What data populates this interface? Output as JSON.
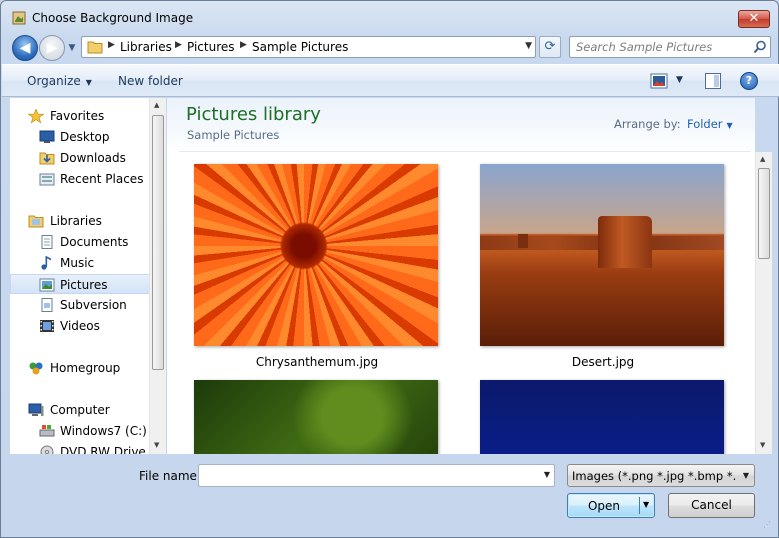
{
  "window": {
    "title": "Choose Background Image",
    "close_label": "✕"
  },
  "nav": {
    "back_glyph": "◀",
    "forward_glyph": "▶",
    "recent_glyph": "▼",
    "refresh_glyph": "⟳"
  },
  "address": {
    "crumbs": [
      "Libraries",
      "Pictures",
      "Sample Pictures"
    ],
    "separator": "▶",
    "dropdown_glyph": "▼"
  },
  "search": {
    "placeholder": "Search Sample Pictures"
  },
  "toolbar": {
    "organize_label": "Organize",
    "new_folder_label": "New folder",
    "caret": "▼",
    "help_label": "?"
  },
  "sidebar": {
    "items": [
      {
        "label": "Favorites",
        "icon": "star-icon"
      },
      {
        "label": "Desktop",
        "icon": "desktop-icon"
      },
      {
        "label": "Downloads",
        "icon": "downloads-folder-icon"
      },
      {
        "label": "Recent Places",
        "icon": "recent-places-icon"
      },
      {
        "label": "Libraries",
        "icon": "library-icon"
      },
      {
        "label": "Documents",
        "icon": "documents-icon"
      },
      {
        "label": "Music",
        "icon": "music-icon"
      },
      {
        "label": "Pictures",
        "icon": "pictures-icon",
        "selected": true
      },
      {
        "label": "Subversion",
        "icon": "subversion-icon"
      },
      {
        "label": "Videos",
        "icon": "videos-icon"
      },
      {
        "label": "Homegroup",
        "icon": "homegroup-icon"
      },
      {
        "label": "Computer",
        "icon": "computer-icon"
      },
      {
        "label": "Windows7 (C:)",
        "icon": "drive-icon"
      },
      {
        "label": "DVD RW Drive (E:",
        "icon": "dvd-drive-icon"
      }
    ]
  },
  "library": {
    "title": "Pictures library",
    "subtitle": "Sample Pictures",
    "arrange_label": "Arrange by:",
    "arrange_value": "Folder"
  },
  "files": [
    {
      "name": "Chrysanthemum.jpg"
    },
    {
      "name": "Desert.jpg"
    },
    {
      "name": ""
    },
    {
      "name": ""
    }
  ],
  "footer": {
    "file_name_label": "File name:",
    "file_name_value": "",
    "file_type": "Images (*.png *.jpg *.bmp *.gif",
    "open_label": "Open",
    "cancel_label": "Cancel"
  },
  "colors": {
    "library_title": "#1e6e23",
    "link_blue": "#1d5fb4",
    "close_red": "#c23b2c",
    "selection": "#d3e3f7"
  }
}
